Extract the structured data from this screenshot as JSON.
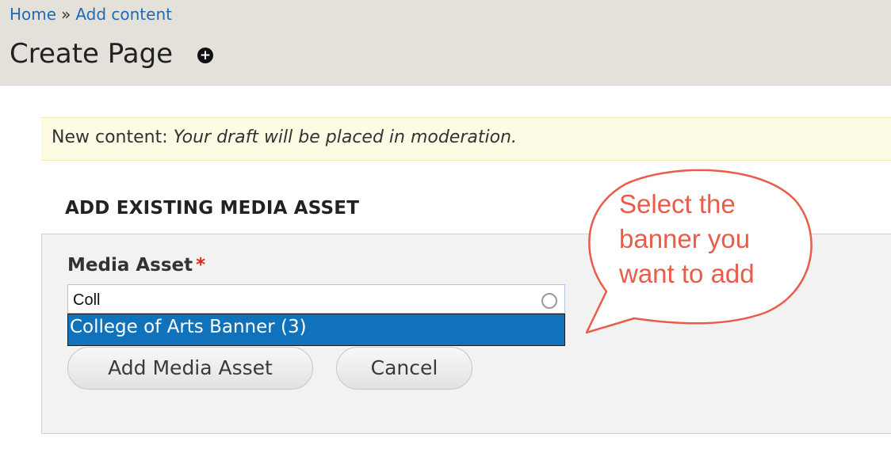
{
  "breadcrumb": {
    "home": "Home",
    "separator": "»",
    "add_content": "Add content"
  },
  "page": {
    "title": "Create Page",
    "shortcut_icon": "plus-circle-icon"
  },
  "message": {
    "label": "New content:",
    "text": "Your draft will be placed in moderation."
  },
  "section": {
    "title": "ADD EXISTING MEDIA ASSET"
  },
  "media_field": {
    "label": "Media Asset",
    "required_marker": "*",
    "value": "Coll",
    "throbber_icon": "autocomplete-throbber-icon",
    "suggestions": [
      "College of Arts Banner (3)"
    ]
  },
  "buttons": {
    "add": "Add Media Asset",
    "cancel": "Cancel"
  },
  "callout": {
    "lines": [
      "Select the",
      "banner you",
      "want to add"
    ],
    "color": "#ea5c4a"
  },
  "colors": {
    "header_bg": "#e3e1da",
    "link": "#1f6bb5",
    "message_bg": "#fdfbe4",
    "selected_suggestion_bg": "#0f72ba",
    "required": "#e0261d"
  }
}
